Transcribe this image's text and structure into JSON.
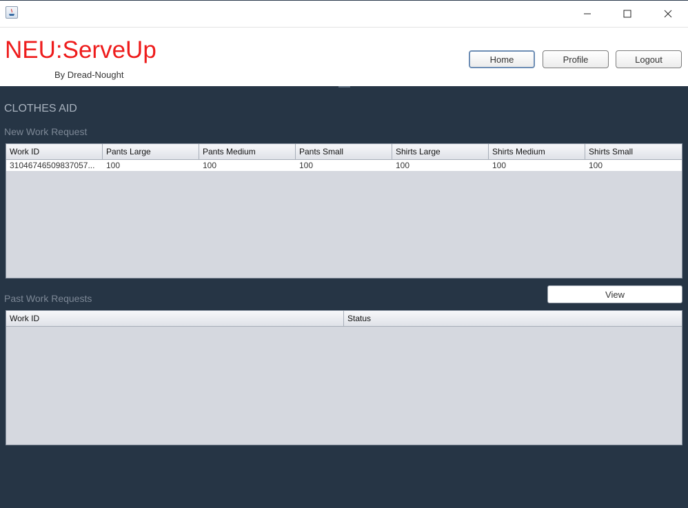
{
  "window": {
    "controls": {
      "minimize_icon": "minimize-icon",
      "maximize_icon": "maximize-icon",
      "close_icon": "close-icon"
    }
  },
  "header": {
    "brand": "NEU:ServeUp",
    "byline": "By Dread-Nought",
    "nav": {
      "home": "Home",
      "profile": "Profile",
      "logout": "Logout"
    }
  },
  "page": {
    "title": "CLOTHES AID",
    "new_request": {
      "label": "New Work Request",
      "columns": [
        "Work ID",
        "Pants Large",
        "Pants Medium",
        "Pants Small",
        "Shirts Large",
        "Shirts Medium",
        "Shirts Small"
      ],
      "rows": [
        [
          "31046746509837057...",
          "100",
          "100",
          "100",
          "100",
          "100",
          "100"
        ]
      ]
    },
    "past_requests": {
      "label": "Past Work Requests",
      "view_button": "View",
      "columns": [
        "Work ID",
        "Status"
      ],
      "rows": []
    }
  },
  "colors": {
    "brand": "#ee1c1c",
    "panel_bg": "#263545",
    "table_bg": "#d5d8df"
  }
}
